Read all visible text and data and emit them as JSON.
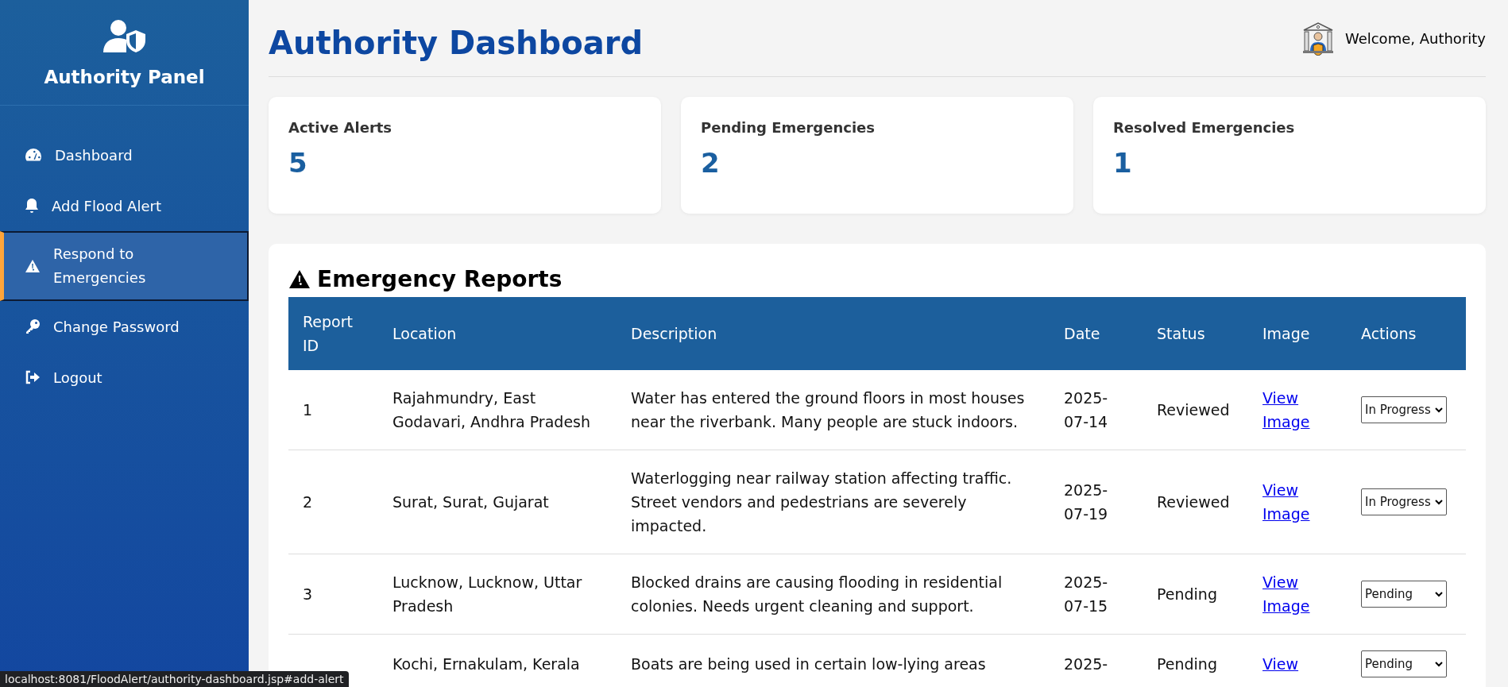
{
  "sidebar": {
    "title": "Authority Panel",
    "items": [
      {
        "label": "Dashboard",
        "selected": false
      },
      {
        "label": "Add Flood Alert",
        "selected": false
      },
      {
        "label": "Respond to Emergencies",
        "selected": true
      },
      {
        "label": "Change Password",
        "selected": false
      },
      {
        "label": "Logout",
        "selected": false
      }
    ]
  },
  "header": {
    "title": "Authority Dashboard",
    "welcome": "Welcome, Authority"
  },
  "stats": [
    {
      "label": "Active Alerts",
      "value": "5"
    },
    {
      "label": "Pending Emergencies",
      "value": "2"
    },
    {
      "label": "Resolved Emergencies",
      "value": "1"
    }
  ],
  "reports": {
    "title": "Emergency Reports",
    "columns": [
      "Report ID",
      "Location",
      "Description",
      "Date",
      "Status",
      "Image",
      "Actions"
    ],
    "rows": [
      {
        "id": "1",
        "location": "Rajahmundry, East Godavari, Andhra Pradesh",
        "description": "Water has entered the ground floors in most houses near the riverbank. Many people are stuck indoors.",
        "date": "2025-07-14",
        "status": "Reviewed",
        "image_link": "View Image",
        "action": "In Progress"
      },
      {
        "id": "2",
        "location": "Surat, Surat, Gujarat",
        "description": "Waterlogging near railway station affecting traffic. Street vendors and pedestrians are severely impacted.",
        "date": "2025-07-19",
        "status": "Reviewed",
        "image_link": "View Image",
        "action": "In Progress"
      },
      {
        "id": "3",
        "location": "Lucknow, Lucknow, Uttar Pradesh",
        "description": "Blocked drains are causing flooding in residential colonies. Needs urgent cleaning and support.",
        "date": "2025-07-15",
        "status": "Pending",
        "image_link": "View Image",
        "action": "Pending"
      },
      {
        "location": "Kochi, Ernakulam, Kerala",
        "description": "Boats are being used in certain low-lying areas",
        "date": "2025-",
        "status": "Pending",
        "image_link": "View",
        "action": "Pending"
      }
    ]
  },
  "status_bar": "localhost:8081/FloodAlert/authority-dashboard.jsp#add-alert"
}
